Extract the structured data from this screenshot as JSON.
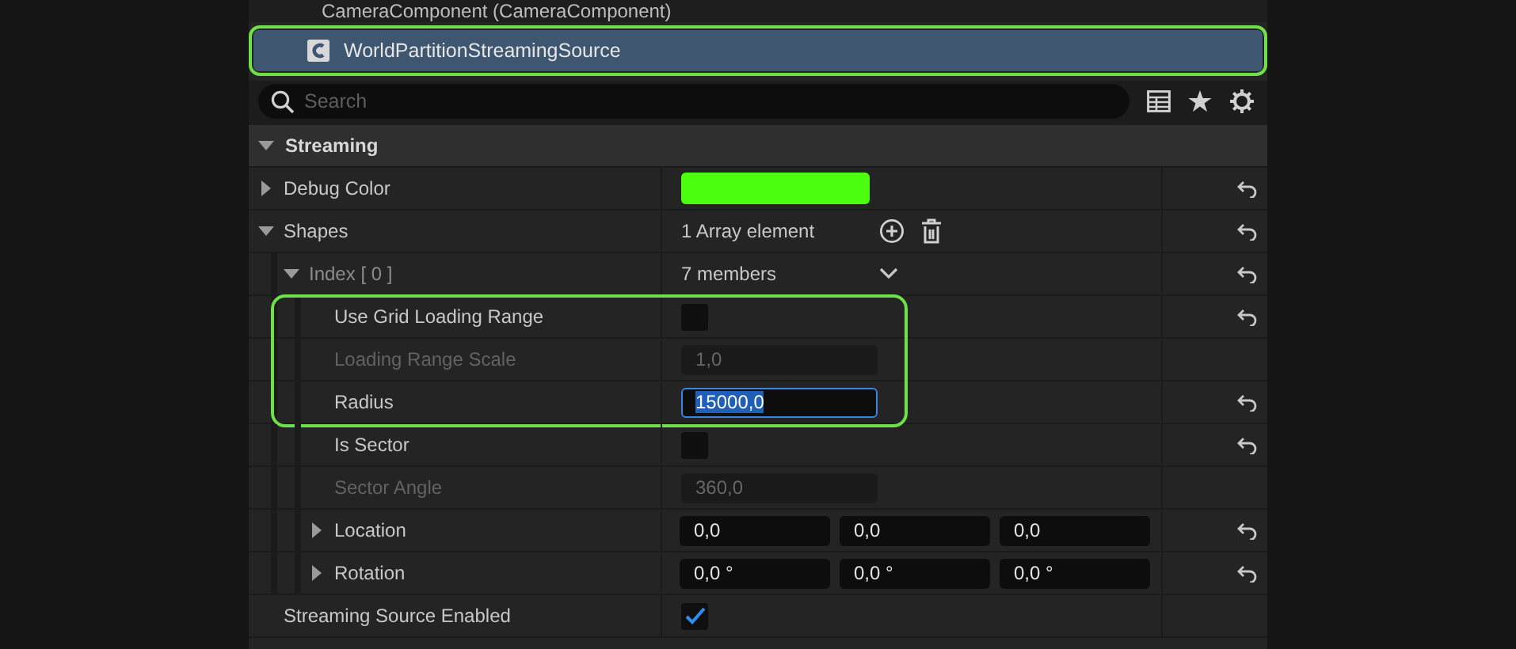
{
  "top_item": {
    "label": "CameraComponent (CameraComponent)"
  },
  "component": {
    "name": "WorldPartitionStreamingSource",
    "selected": true,
    "highlighted": true
  },
  "search": {
    "placeholder": "Search"
  },
  "section": {
    "title": "Streaming",
    "expanded": true
  },
  "rows": [
    {
      "label": "Debug Color",
      "kind": "color",
      "color": "#4cff0f",
      "expanded": false,
      "resettable": true
    },
    {
      "label": "Shapes",
      "kind": "array",
      "value": "1 Array element",
      "expanded": true,
      "resettable": true,
      "children": [
        {
          "label": "Index [ 0 ]",
          "kind": "struct",
          "value": "7 members",
          "expanded": true,
          "resettable": true,
          "children": [
            {
              "label": "Use Grid Loading Range",
              "kind": "checkbox",
              "checked": false,
              "resettable": true,
              "highlighted": true
            },
            {
              "label": "Loading Range Scale",
              "kind": "number",
              "value": "1,0",
              "disabled": true,
              "resettable": false,
              "highlighted": true
            },
            {
              "label": "Radius",
              "kind": "number",
              "value": "15000,0",
              "focused": true,
              "resettable": true,
              "highlighted": true
            },
            {
              "label": "Is Sector",
              "kind": "checkbox",
              "checked": false,
              "resettable": true
            },
            {
              "label": "Sector Angle",
              "kind": "number",
              "value": "360,0",
              "disabled": true,
              "resettable": false
            },
            {
              "label": "Location",
              "kind": "vector",
              "values": [
                "0,0",
                "0,0",
                "0,0"
              ],
              "expanded": false,
              "resettable": true
            },
            {
              "label": "Rotation",
              "kind": "vector",
              "values": [
                "0,0 °",
                "0,0 °",
                "0,0 °"
              ],
              "expanded": false,
              "resettable": true
            }
          ]
        }
      ]
    },
    {
      "label": "Streaming Source Enabled",
      "kind": "checkbox",
      "checked": true,
      "resettable": false
    }
  ]
}
